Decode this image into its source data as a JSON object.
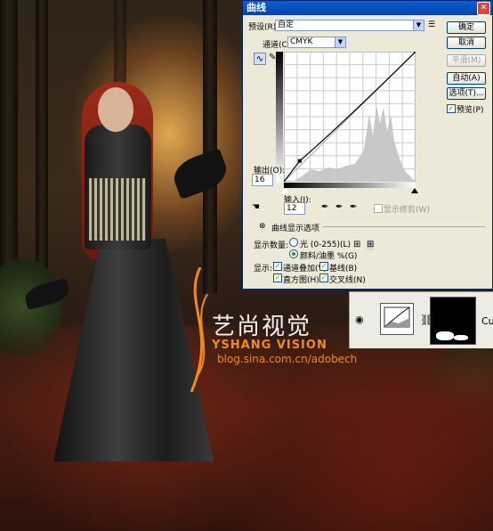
{
  "dialog": {
    "title": "曲线",
    "preset_label": "预设(R):",
    "preset_value": "自定",
    "channel_label": "通道(C):",
    "channel_value": "CMYK",
    "output_label": "输出(O):",
    "output_value": "16",
    "input_label": "输入(I):",
    "input_value": "12",
    "show_clipping_label": "显示修剪(W)",
    "curve_display_options_label": "曲线显示选项",
    "show_amount_label": "显示数量:",
    "light_option_label": "光 (0-255)(L)",
    "pigment_option_label": "颜料/油墨 %(G)",
    "show_label": "显示:",
    "channel_overlay_label": "通道叠加(V)",
    "baseline_label": "基线(B)",
    "histogram_label": "直方图(H)",
    "intersection_label": "交叉线(N)",
    "buttons": {
      "ok": "确定",
      "cancel": "取消",
      "smooth": "平滑(M)",
      "auto": "自动(A)",
      "options": "选项(T)...",
      "preview": "预览(P)"
    },
    "options": {
      "pigment_selected": true,
      "channel_overlay": true,
      "baseline": true,
      "histogram": true,
      "intersection": true,
      "preview": true,
      "show_clipping": false
    },
    "curve_points": [
      [
        0,
        0
      ],
      [
        12,
        16
      ],
      [
        100,
        100
      ]
    ]
  },
  "layers": {
    "visible_text": "Cu"
  },
  "watermark": {
    "cn": "艺尚视觉",
    "en": "YSHANG VISION",
    "url": "blog.sina.com.cn/adobech"
  },
  "colors": {
    "titlebar": "#0842a8",
    "dialog_bg": "#ece9d8",
    "watermark_orange": "#f08a1a"
  }
}
